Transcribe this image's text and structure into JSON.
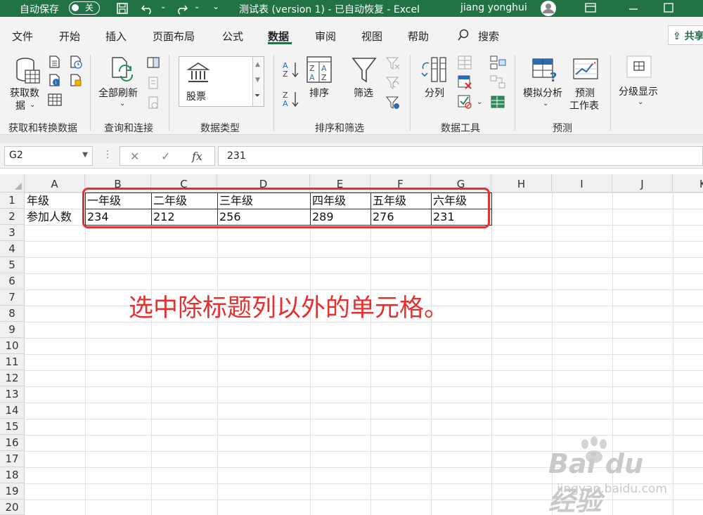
{
  "titlebar": {
    "autosave_label": "自动保存",
    "autosave_toggle": "关",
    "doc_title": "测试表 (version 1)  -  已自动恢复  -  Excel",
    "user_name": "jiang yonghui"
  },
  "menu": {
    "tabs": [
      "文件",
      "开始",
      "插入",
      "页面布局",
      "公式",
      "数据",
      "审阅",
      "视图",
      "帮助"
    ],
    "active_tab": "数据",
    "search_label": "搜索",
    "share_label": "共享"
  },
  "ribbon": {
    "get_data_line1": "获取数",
    "get_data_line2": "据",
    "refresh_all": "全部刷新",
    "stocks": "股票",
    "sort": "排序",
    "filter": "筛选",
    "text_to_columns": "分列",
    "what_if": "模拟分析",
    "forecast_line1": "预测",
    "forecast_line2": "工作表",
    "outline": "分级显示",
    "groups": {
      "get_transform": "获取和转换数据",
      "queries": "查询和连接",
      "data_types": "数据类型",
      "sort_filter": "排序和筛选",
      "data_tools": "数据工具",
      "forecast": "预测"
    }
  },
  "formula_bar": {
    "name_box": "G2",
    "fx_label": "fx",
    "formula_value": "231"
  },
  "sheet": {
    "columns": [
      "A",
      "B",
      "C",
      "D",
      "E",
      "F",
      "G",
      "H",
      "I",
      "J",
      "K"
    ],
    "rows": [
      "1",
      "2",
      "3",
      "4",
      "5",
      "6",
      "7",
      "8",
      "9",
      "10",
      "11",
      "12",
      "13",
      "14",
      "15",
      "16",
      "17",
      "18",
      "19",
      "20"
    ],
    "row1": [
      "年级",
      "一年级",
      "二年级",
      "三年级",
      "四年级",
      "五年级",
      "六年级"
    ],
    "row2": [
      "参加人数",
      "234",
      "212",
      "256",
      "289",
      "276",
      "231"
    ]
  },
  "annotation": "选中除标题列以外的单元格。",
  "watermark": {
    "brand": "Bai du 经验",
    "url": "jingyan.baidu.com"
  },
  "colors": {
    "excel_green": "#217346",
    "annotation_red": "#e53030"
  }
}
